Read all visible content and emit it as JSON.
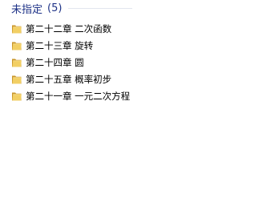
{
  "group": {
    "title": "未指定",
    "count": "(5)"
  },
  "colors": {
    "group_title": "#1e3287",
    "folder_front": "#e8c14f",
    "folder_back": "#c9962a"
  },
  "files": [
    {
      "name": "第二十二章 二次函数",
      "icon": "folder-icon"
    },
    {
      "name": "第二十三章 旋转",
      "icon": "folder-icon"
    },
    {
      "name": "第二十四章 圆",
      "icon": "folder-icon"
    },
    {
      "name": "第二十五章 概率初步",
      "icon": "folder-icon"
    },
    {
      "name": "第二十一章 一元二次方程",
      "icon": "folder-icon"
    }
  ]
}
